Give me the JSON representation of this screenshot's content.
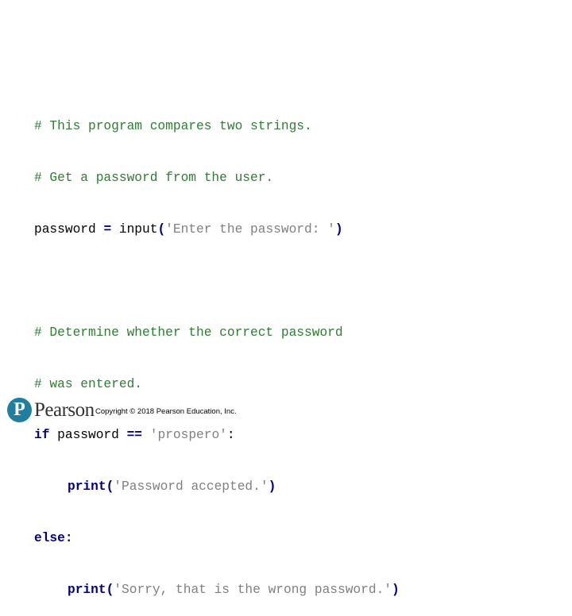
{
  "code": {
    "line1_comment": "# This program compares two strings.",
    "line2_comment": "# Get a password from the user.",
    "line3_var": "password ",
    "line3_eq": "=",
    "line3_func": " input",
    "line3_paren_open": "(",
    "line3_str": "'Enter the password: '",
    "line3_paren_close": ")",
    "line4_comment": "# Determine whether the correct password",
    "line5_comment": "# was entered.",
    "line6_kw": "if",
    "line6_var": " password ",
    "line6_op": "==",
    "line6_str": " 'prospero'",
    "line6_colon": ":",
    "line7_func": "print",
    "line7_paren_open": "(",
    "line7_str": "'Password accepted.'",
    "line7_paren_close": ")",
    "line8_kw": "else",
    "line8_colon": ":",
    "line9_func": "print",
    "line9_paren_open": "(",
    "line9_str": "'Sorry, that is the wrong password.'",
    "line9_paren_close": ")"
  },
  "footer": {
    "logo_letter": "P",
    "logo_name": "Pearson",
    "copyright": "Copyright © 2018 Pearson Education, Inc."
  },
  "colors": {
    "comment": "#2E7D32",
    "keyword": "#000080",
    "string": "#808080",
    "logo": "#1E7FA0"
  }
}
